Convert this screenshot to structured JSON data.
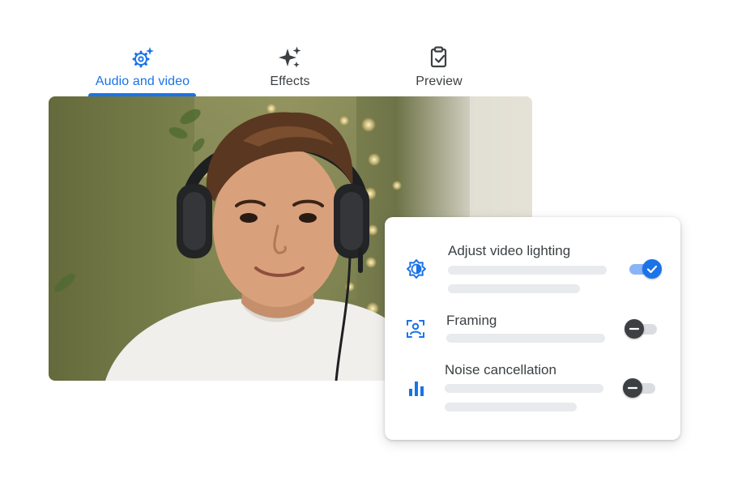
{
  "tabs": [
    {
      "label": "Audio and video",
      "icon": "gear-sparkle-icon",
      "active": true
    },
    {
      "label": "Effects",
      "icon": "sparkle-icon",
      "active": false
    },
    {
      "label": "Preview",
      "icon": "clipboard-check-icon",
      "active": false
    }
  ],
  "settings": [
    {
      "title": "Adjust video lighting",
      "icon": "brightness-icon",
      "enabled": true
    },
    {
      "title": "Framing",
      "icon": "framing-icon",
      "enabled": false
    },
    {
      "title": "Noise cancellation",
      "icon": "equalizer-icon",
      "enabled": false
    }
  ],
  "colors": {
    "accent": "#1a73e8",
    "text": "#3c4043",
    "placeholder": "#e8eaed"
  }
}
